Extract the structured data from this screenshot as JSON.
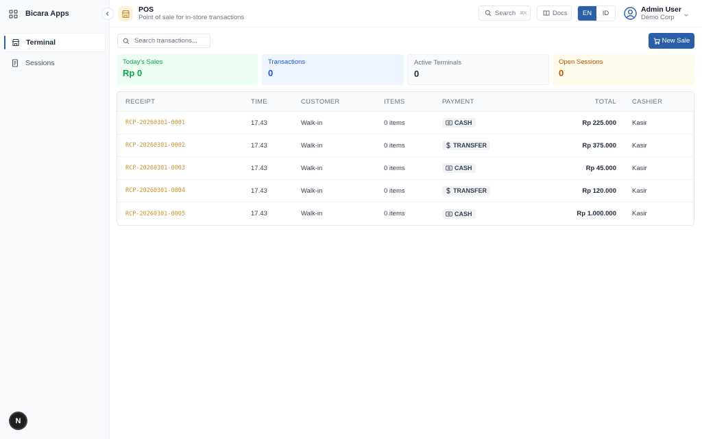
{
  "sidebar": {
    "brand": "Bicara Apps",
    "items": [
      {
        "label": "Terminal",
        "icon": "store-icon",
        "active": true
      },
      {
        "label": "Sessions",
        "icon": "receipt-icon",
        "active": false
      }
    ],
    "bottom_badge": "N"
  },
  "header": {
    "title": "POS",
    "subtitle": "Point of sale for in-store transactions",
    "search_label": "Search",
    "search_shortcut": "⌘K",
    "docs_label": "Docs",
    "languages": [
      "EN",
      "ID"
    ],
    "active_language": "EN",
    "user_name": "Admin User",
    "user_org": "Demo Corp"
  },
  "toolbar": {
    "search_placeholder": "Search transactions...",
    "new_sale_label": "New Sale"
  },
  "stats": [
    {
      "label": "Today's Sales",
      "value": "Rp 0"
    },
    {
      "label": "Transactions",
      "value": "0"
    },
    {
      "label": "Active Terminals",
      "value": "0"
    },
    {
      "label": "Open Sessions",
      "value": "0"
    }
  ],
  "table": {
    "columns": [
      "RECEIPT",
      "TIME",
      "CUSTOMER",
      "ITEMS",
      "PAYMENT",
      "TOTAL",
      "CASHIER"
    ],
    "rows": [
      {
        "receipt": "RCP-20260301-0001",
        "time": "17.43",
        "customer": "Walk-in",
        "items": "0 items",
        "payment": "CASH",
        "payment_icon": "cash-icon",
        "total": "Rp 225.000",
        "cashier": "Kasir"
      },
      {
        "receipt": "RCP-20260301-0002",
        "time": "17.43",
        "customer": "Walk-in",
        "items": "0 items",
        "payment": "TRANSFER",
        "payment_icon": "dollar-icon",
        "total": "Rp 375.000",
        "cashier": "Kasir"
      },
      {
        "receipt": "RCP-20260301-0003",
        "time": "17.43",
        "customer": "Walk-in",
        "items": "0 items",
        "payment": "CASH",
        "payment_icon": "cash-icon",
        "total": "Rp 45.000",
        "cashier": "Kasir"
      },
      {
        "receipt": "RCP-20260301-0004",
        "time": "17.43",
        "customer": "Walk-in",
        "items": "0 items",
        "payment": "TRANSFER",
        "payment_icon": "dollar-icon",
        "total": "Rp 120.000",
        "cashier": "Kasir"
      },
      {
        "receipt": "RCP-20260301-0005",
        "time": "17.43",
        "customer": "Walk-in",
        "items": "0 items",
        "payment": "CASH",
        "payment_icon": "cash-icon",
        "total": "Rp 1.000.000",
        "cashier": "Kasir"
      }
    ]
  },
  "colors": {
    "accent": "#2b5fa8",
    "receipt": "#c8922e",
    "sales_green": "#16a34a",
    "transactions_blue": "#1d4ed8",
    "sessions_amber": "#b45309"
  }
}
